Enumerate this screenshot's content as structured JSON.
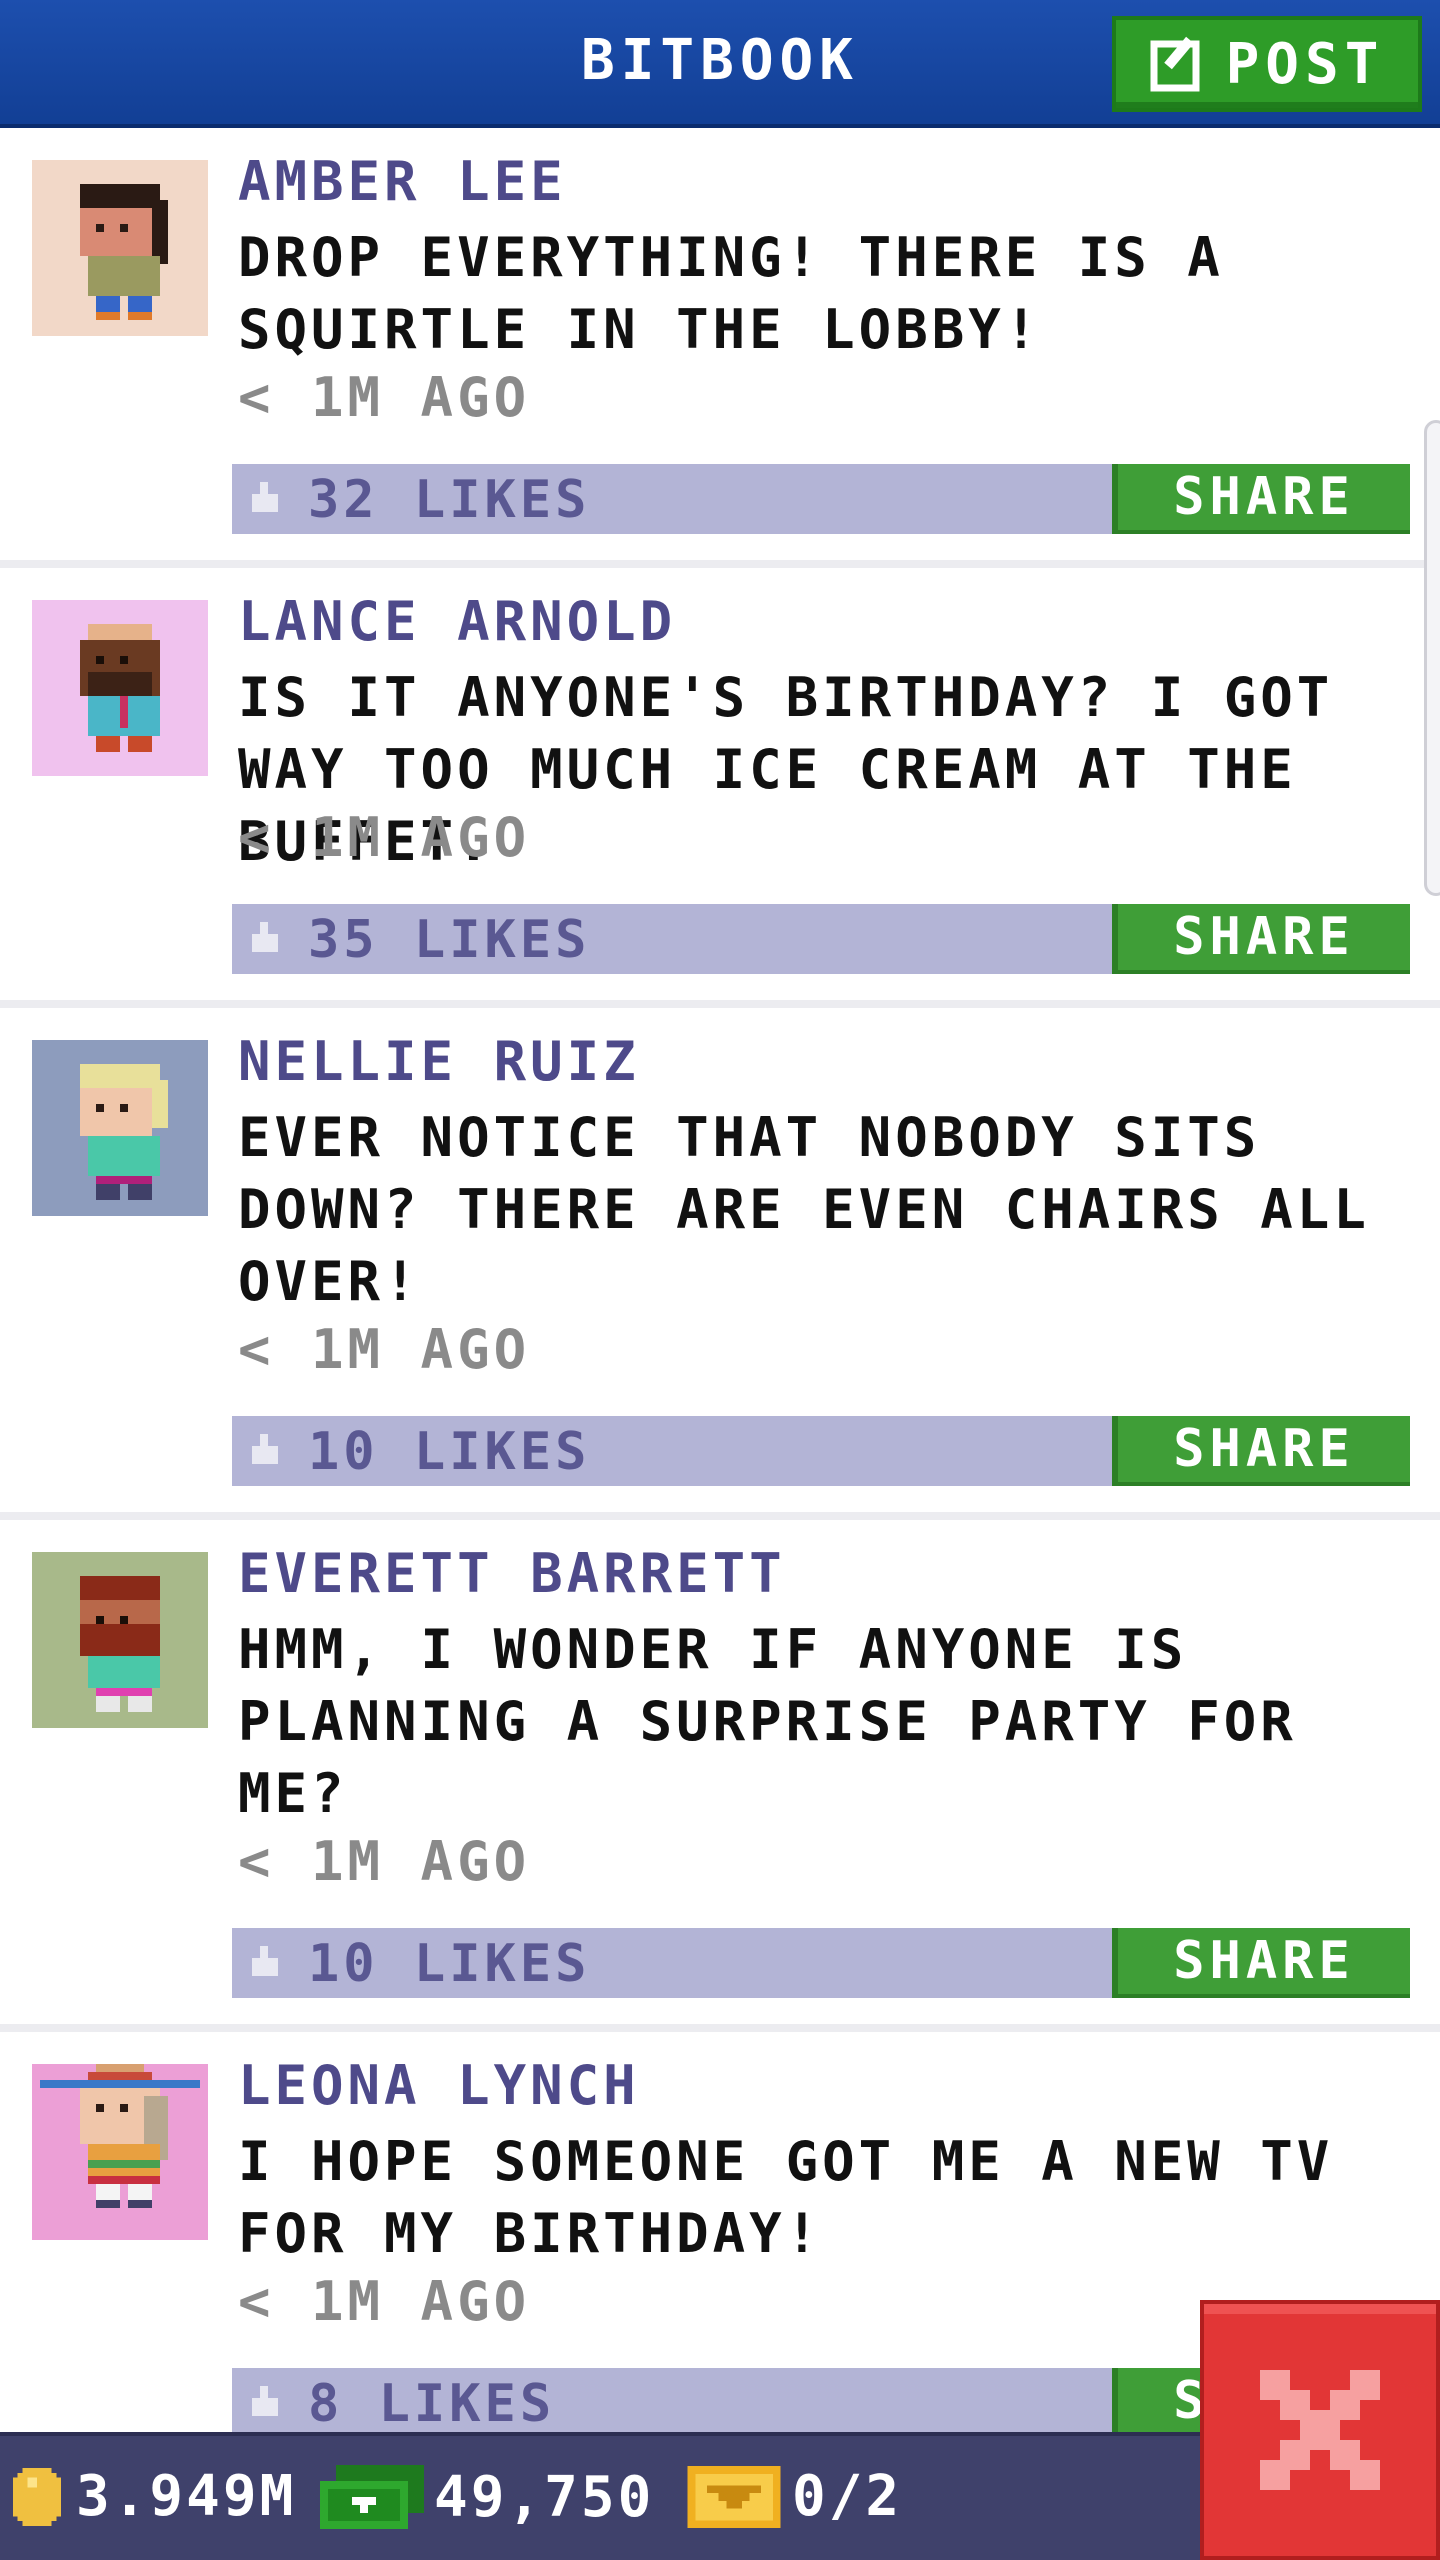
{
  "header": {
    "title": "BITBOOK",
    "post_label": "POST"
  },
  "posts": [
    {
      "name": "AMBER LEE",
      "msg": "DROP EVERYTHING! THERE IS A SQUIRTLE IN THE LOBBY!",
      "time": "< 1M AGO",
      "likes": "32 LIKES",
      "share": "SHARE",
      "avatar_bg": "#f2d8c8"
    },
    {
      "name": "LANCE ARNOLD",
      "msg": "IS IT ANYONE'S BIRTHDAY? I GOT WAY TOO MUCH ICE CREAM AT THE BUFFET.",
      "time": "< 1M AGO",
      "likes": "35 LIKES",
      "share": "SHARE",
      "avatar_bg": "#f0c2ee"
    },
    {
      "name": "NELLIE RUIZ",
      "msg": "EVER NOTICE THAT NOBODY SITS DOWN? THERE ARE EVEN CHAIRS ALL OVER!",
      "time": "< 1M AGO",
      "likes": "10 LIKES",
      "share": "SHARE",
      "avatar_bg": "#8d9cbd"
    },
    {
      "name": "EVERETT BARRETT",
      "msg": "HMM, I WONDER IF ANYONE IS PLANNING A SURPRISE PARTY FOR ME?",
      "time": "< 1M AGO",
      "likes": "10 LIKES",
      "share": "SHARE",
      "avatar_bg": "#a8b98a"
    },
    {
      "name": "LEONA LYNCH",
      "msg": "I HOPE SOMEONE GOT ME A NEW TV FOR MY BIRTHDAY!",
      "time": "< 1M AGO",
      "likes": "8 LIKES",
      "share": "SHARE",
      "avatar_bg": "#ec9fd6"
    }
  ],
  "bottom_bar": {
    "coins": "3.949M",
    "bux": "49,750",
    "tickets": "0/2"
  },
  "colors": {
    "header": "#1d4fae",
    "share": "#3f9e37",
    "likes_bar": "#b3b4d6",
    "name": "#4e4a8a",
    "close": "#e23636"
  },
  "icons": [
    "edit-icon",
    "thumbs-up-icon",
    "coin-icon",
    "bux-icon",
    "ticket-icon",
    "close-icon"
  ]
}
